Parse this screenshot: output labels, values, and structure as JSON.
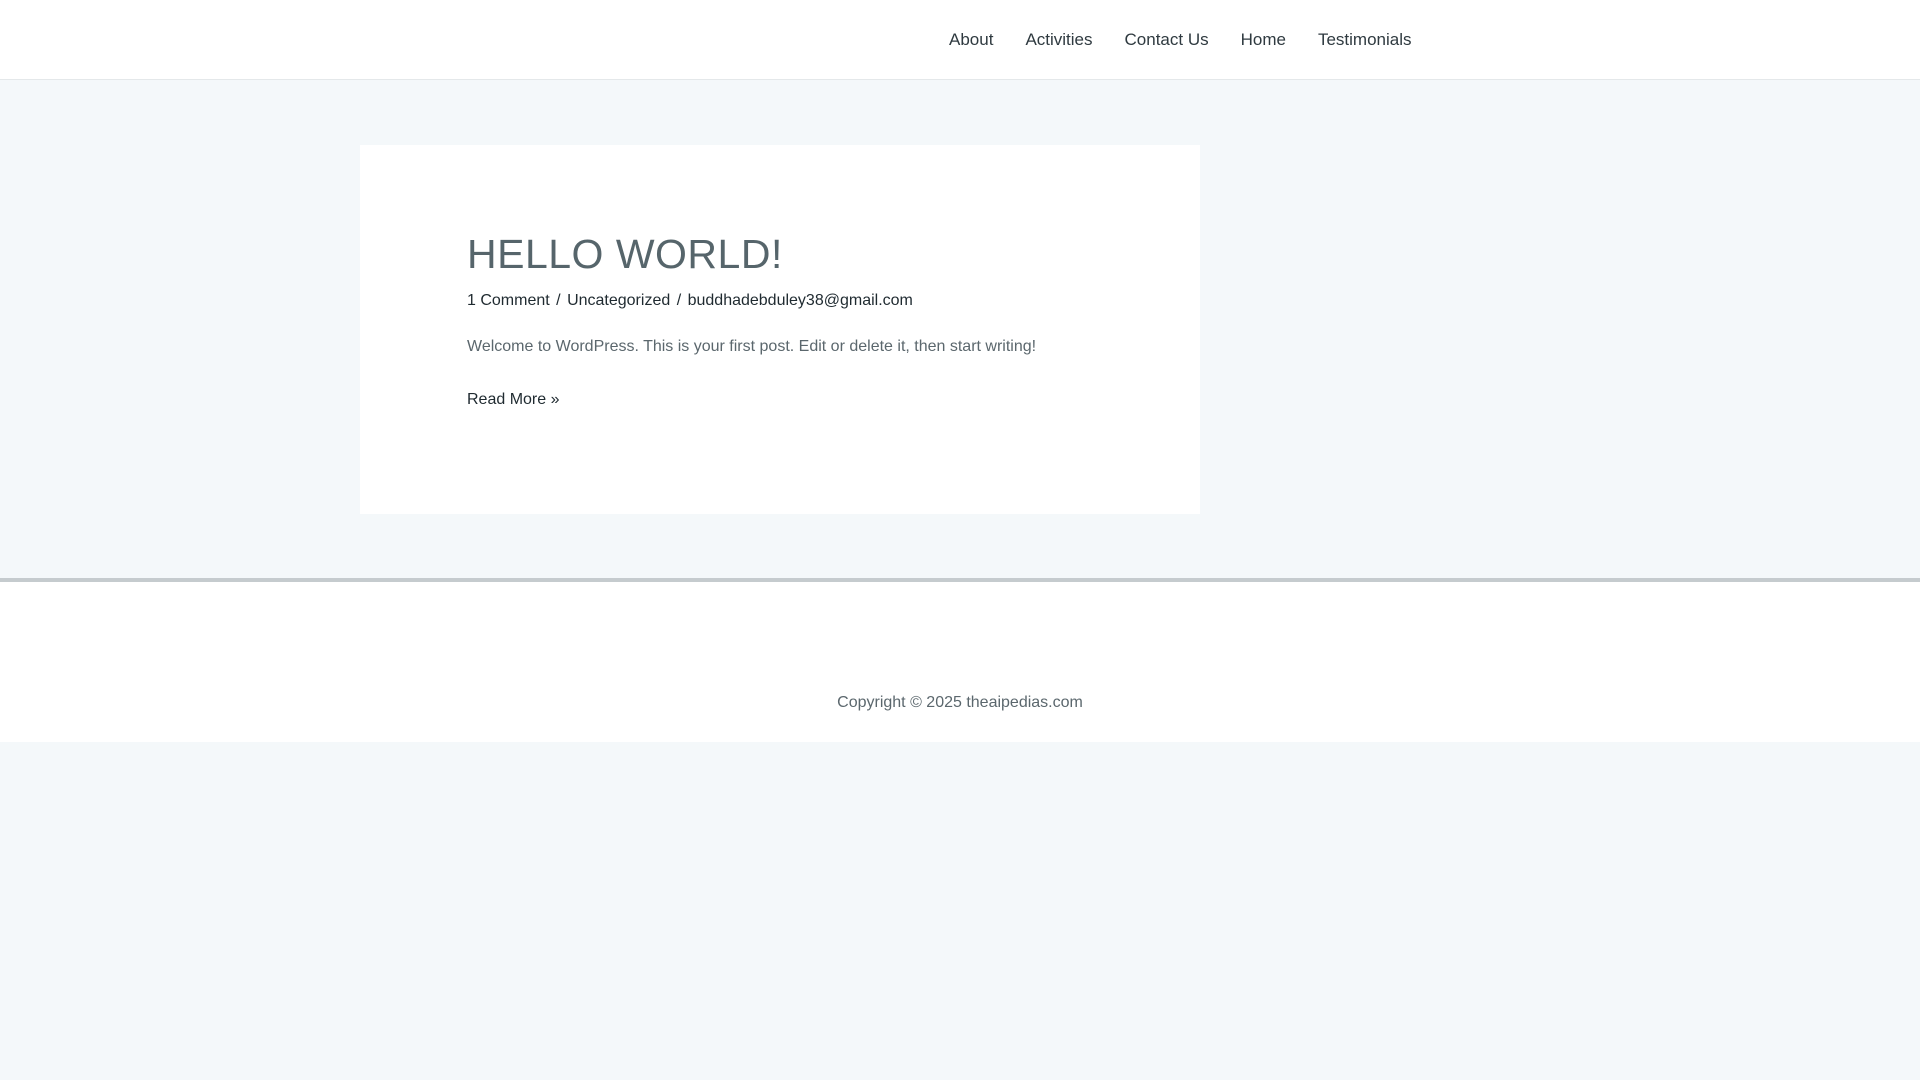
{
  "nav": {
    "items": [
      {
        "label": "About"
      },
      {
        "label": "Activities"
      },
      {
        "label": "Contact Us"
      },
      {
        "label": "Home"
      },
      {
        "label": "Testimonials"
      }
    ]
  },
  "post": {
    "title": "HELLO WORLD!",
    "meta": {
      "comments": "1 Comment",
      "separator": "/",
      "category": "Uncategorized",
      "author": "buddhadebduley38@gmail.com"
    },
    "excerpt": "Welcome to WordPress. This is your first post. Edit or delete it, then start writing!",
    "read_more": "Read More »"
  },
  "footer": {
    "copyright": "Copyright © 2025 theaipedias.com"
  },
  "colors": {
    "page_background": "#f4f8fa",
    "title": "#56656b",
    "text": "#5b676d",
    "link": "#1f2a30"
  }
}
